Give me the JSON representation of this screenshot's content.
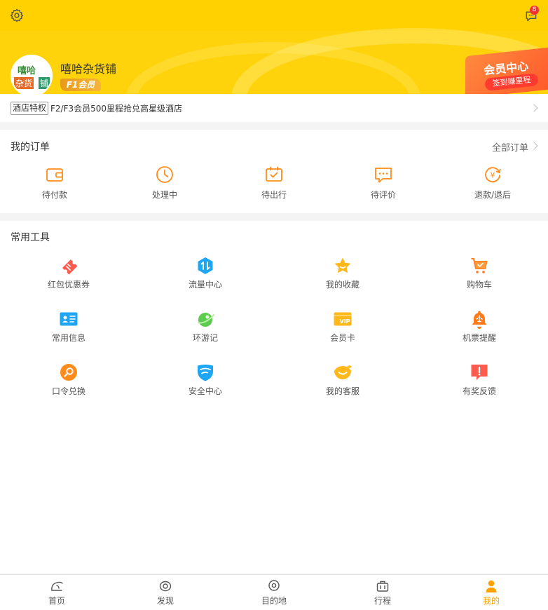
{
  "header": {
    "store_name": "嘻哈杂货铺",
    "member_level": "F1会员",
    "message_count": "8",
    "avatar_text": [
      "嘻哈",
      "杂货",
      "铺"
    ],
    "vip_center": {
      "title": "会员中心",
      "button": "签到赚里程"
    }
  },
  "promo": {
    "tag": "酒店特权",
    "text": "F2/F3会员500里程抢兑高星级酒店"
  },
  "orders": {
    "title": "我的订单",
    "all_label": "全部订单",
    "items": [
      {
        "label": "待付款",
        "icon": "wallet-icon"
      },
      {
        "label": "处理中",
        "icon": "clock-icon"
      },
      {
        "label": "待出行",
        "icon": "calendar-check-icon"
      },
      {
        "label": "待评价",
        "icon": "comment-icon"
      },
      {
        "label": "退款/退后",
        "icon": "refund-icon"
      }
    ]
  },
  "tools": {
    "title": "常用工具",
    "items": [
      {
        "label": "红包优惠券",
        "icon": "coupon-icon"
      },
      {
        "label": "流量中心",
        "icon": "traffic-icon"
      },
      {
        "label": "我的收藏",
        "icon": "star-icon"
      },
      {
        "label": "购物车",
        "icon": "cart-icon"
      },
      {
        "label": "常用信息",
        "icon": "id-card-icon"
      },
      {
        "label": "环游记",
        "icon": "globe-icon"
      },
      {
        "label": "会员卡",
        "icon": "vip-card-icon"
      },
      {
        "label": "机票提醒",
        "icon": "bell-icon"
      },
      {
        "label": "口令兑换",
        "icon": "search-icon"
      },
      {
        "label": "安全中心",
        "icon": "shield-icon"
      },
      {
        "label": "我的客服",
        "icon": "service-icon"
      },
      {
        "label": "有奖反馈",
        "icon": "feedback-icon"
      }
    ]
  },
  "tabbar": {
    "items": [
      {
        "label": "首页",
        "icon": "home-icon"
      },
      {
        "label": "发现",
        "icon": "discover-icon"
      },
      {
        "label": "目的地",
        "icon": "destination-icon"
      },
      {
        "label": "行程",
        "icon": "trip-icon"
      },
      {
        "label": "我的",
        "icon": "profile-icon"
      }
    ],
    "active_index": 4
  },
  "colors": {
    "brand_yellow": "#ffd100",
    "accent_orange": "#ff8c1a",
    "active_tab": "#ffa200",
    "badge_red": "#f23030"
  }
}
